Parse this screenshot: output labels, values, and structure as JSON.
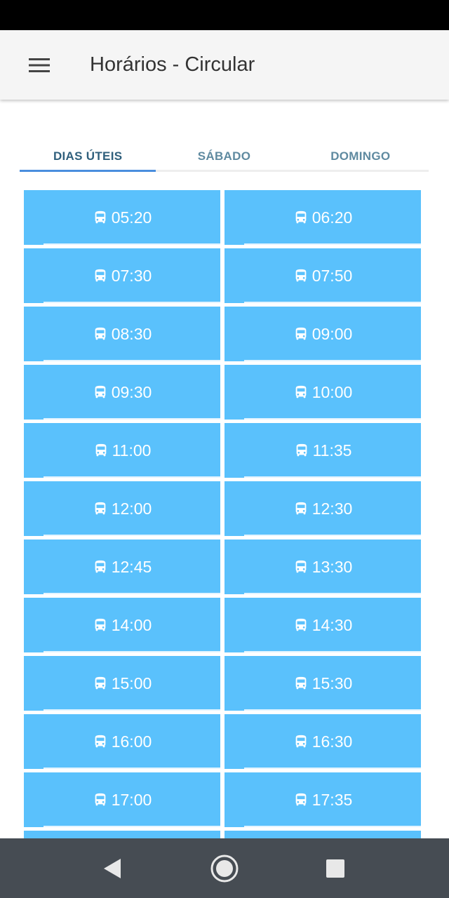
{
  "app_bar": {
    "title": "Horários - Circular",
    "menu_icon": "hamburger-menu-icon"
  },
  "tabs": [
    {
      "label": "DIAS ÚTEIS",
      "active": true
    },
    {
      "label": "SÁBADO",
      "active": false
    },
    {
      "label": "DOMINGO",
      "active": false
    }
  ],
  "schedule": {
    "cell_icon": "bus-icon",
    "times": [
      "05:20",
      "06:20",
      "07:30",
      "07:50",
      "08:30",
      "09:00",
      "09:30",
      "10:00",
      "11:00",
      "11:35",
      "12:00",
      "12:30",
      "12:45",
      "13:30",
      "14:00",
      "14:30",
      "15:00",
      "15:30",
      "16:00",
      "16:30",
      "17:00",
      "17:35",
      "",
      ""
    ]
  },
  "nav_bar": {
    "back_icon": "back-triangle-icon",
    "home_icon": "home-circle-icon",
    "recents_icon": "recents-square-icon"
  },
  "colors": {
    "cell_background": "#5ac1fc",
    "tab_indicator": "#4a8ede",
    "active_tab_text": "#2f5f7c",
    "inactive_tab_text": "#5f8aa0",
    "nav_bar": "#464c53"
  }
}
